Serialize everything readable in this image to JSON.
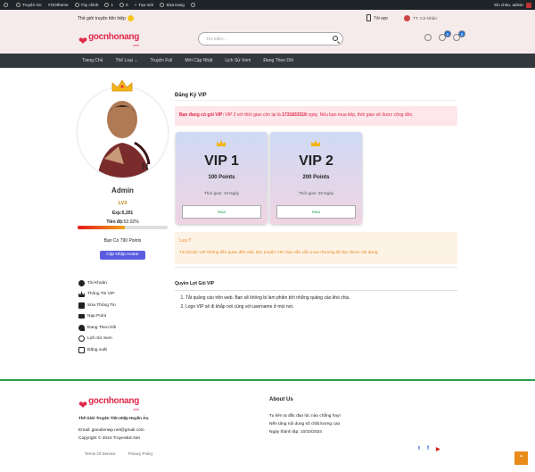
{
  "adminbar": {
    "items": [
      "Truyện Go",
      "YOOtheme",
      "Tùy chỉnh",
      "1",
      "0",
      "Tạo mới",
      "Sửa trang"
    ],
    "greeting": "Xin chào, admin"
  },
  "header": {
    "tagline": "Thế giới truyện tiên hiệp",
    "app": "Tải app",
    "user": "TT. Cá Nhân",
    "logo": "gocnhonang",
    "logo_sub": ".com",
    "search_placeholder": "Tìm kiếm...",
    "badge1": "0",
    "badge2": "0"
  },
  "nav": {
    "items": [
      "Trang Chủ",
      "Thể Loại ⌄",
      "Truyện Full",
      "Mới Cập Nhật",
      "Lịch Sử Xem",
      "Đang Theo Dõi"
    ]
  },
  "profile": {
    "name": "Admin",
    "level": "LV3",
    "exp": "Exp:5,201",
    "progress_label": "Tiến độ:",
    "progress_value": "52.02%",
    "progress": 0.5202,
    "coins": "Bạn Có 790 Points",
    "update_btn": "Cập Nhập Avatar"
  },
  "menu": [
    "Tài Khoản",
    "Thông Tin VIP",
    "Sửa Thông Tin",
    "Nạp Point",
    "Đang Theo Dõi",
    "Lịch Sử Xem",
    "Đăng xuất"
  ],
  "vip": {
    "title": "Đăng Ký VIP",
    "alert_bold": "Bạn đang có gói VIP:",
    "alert_rest": " VIP 2 với thời gian còn lại là ",
    "alert_num": "1731833318",
    "alert_tail": " ngày. Nếu bạn mua tiếp, thời gian sẽ được cộng dồn.",
    "cards": [
      {
        "name": "VIP 1",
        "points": "100 Points",
        "time": "Thời gian: 10 Ngày",
        "buy": "Mua"
      },
      {
        "name": "VIP 2",
        "points": "200 Points",
        "time": "Thời gian: 30 Ngày",
        "buy": "Mua"
      }
    ],
    "note_title": "Lưu Ý",
    "note_text": "Tài khoản VIP không liên quan đến việc đọc truyện VIP, bạn vẫn cần mua chương để đọc được nội dung.",
    "rights_title": "Quyền Lợi Gói VIP",
    "rights": [
      "Tắt quảng cáo trên web. Bạn sẽ không bị làm phiền bởi những quảng cáo khó chịu.",
      "Logo VIP sẽ đi khắp nơi cùng với username ở mọi nơi."
    ]
  },
  "footer": {
    "desc": "Thế Giới Truyện Tiên Hiệp Huyền Ảo.",
    "email": "Email: giaodienwp.net@gmail.com",
    "copy": "Copyright © 2024 TruyenBiz.Net",
    "links": [
      "Terms Of Service",
      "Privacy Policy"
    ],
    "about_title": "About Us",
    "about": [
      "Tu tiên ta đắc đạo lúc nào chẳng hay!",
      "Nền tảng nội dung số chất lượng cao",
      "Ngày thành lập: 10/10/2024"
    ]
  }
}
